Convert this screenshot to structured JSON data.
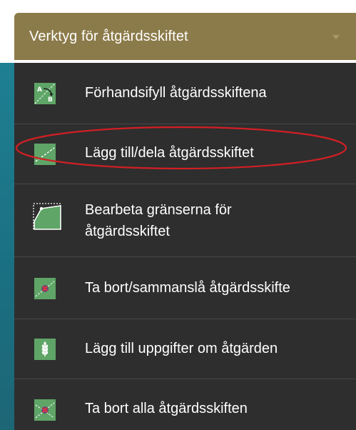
{
  "dropdown": {
    "title": "Verktyg för åtgärdsskiftet"
  },
  "menu": {
    "items": [
      {
        "label": "Förhandsifyll åtgärdsskiftena",
        "icon": "prefill-ab-icon"
      },
      {
        "label": "Lägg till/dela åtgärdsskiftet",
        "icon": "split-line-icon"
      },
      {
        "label_line1": "Bearbeta gränserna för",
        "label_line2": "åtgärdsskiftet",
        "icon": "edit-boundary-icon"
      },
      {
        "label": "Ta bort/sammanslå åtgärdsskifte",
        "icon": "remove-merge-icon"
      },
      {
        "label": "Lägg till uppgifter om åtgärden",
        "icon": "crop-info-icon"
      },
      {
        "label": "Ta bort alla åtgärdsskiften",
        "icon": "remove-all-icon"
      }
    ],
    "highlighted_item": "Lägg till/dela åtgärdsskiftet"
  },
  "colors": {
    "header_bg": "#8c7b4a",
    "menu_bg": "#2e2e2e",
    "icon_green": "#5fa567",
    "annotation_red": "#d21f24",
    "side_teal": "#1f7f93"
  }
}
